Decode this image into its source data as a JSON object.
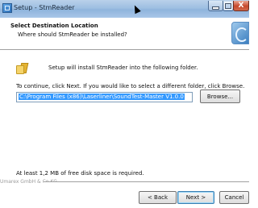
{
  "window": {
    "title": "Setup - StmReader",
    "controls": {
      "minimize": "minimize",
      "maximize": "maximize",
      "close": "X"
    }
  },
  "header": {
    "title": "Select Destination Location",
    "subtitle": "Where should StmReader be installed?",
    "logo_icon": "setup-logo-icon"
  },
  "body": {
    "intro_text": "Setup will install StmReader into the following folder.",
    "continue_text": "To continue, click Next. If you would like to select a different folder, click Browse.",
    "install_path": "C:\\Program Files (x86)\\Laserliner\\SoundTest-Master V1.0.0",
    "browse_label": "Browse...",
    "space_required": "At least 1,2 MB of free disk space is required."
  },
  "footer": {
    "company": "Umarex GmbH & Co KG",
    "back_label": "< Back",
    "next_label": "Next >",
    "cancel_label": "Cancel"
  },
  "colors": {
    "selection": "#3399ff",
    "close_button": "#c7482c",
    "titlebar": "#9ebfe2"
  }
}
